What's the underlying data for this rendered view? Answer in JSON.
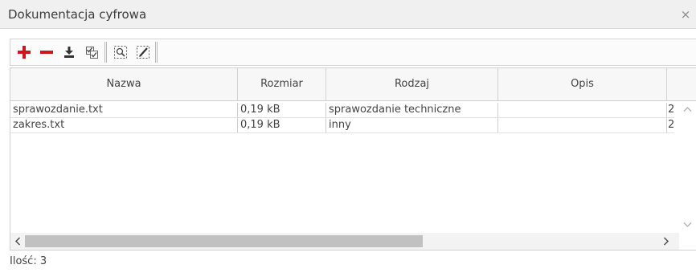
{
  "window": {
    "title": "Dokumentacja cyfrowa",
    "close_glyph": "×"
  },
  "toolbar": {
    "buttons": [
      {
        "icon": "plus-icon",
        "color": "#d0151b"
      },
      {
        "icon": "minus-icon",
        "color": "#d0151b"
      },
      {
        "icon": "download-icon",
        "color": "#333333"
      },
      {
        "icon": "checklist-icon",
        "color": "#555555"
      },
      {
        "icon": "zoom-selection-icon",
        "color": "#555555"
      },
      {
        "icon": "edit-selection-icon",
        "color": "#555555"
      }
    ]
  },
  "grid": {
    "columns": [
      "Nazwa",
      "Rozmiar",
      "Rodzaj",
      "Opis"
    ],
    "rows": [
      {
        "nazwa": "sprawozdanie.txt",
        "rozmiar": "0,19 kB",
        "rodzaj": "sprawozdanie techniczne",
        "opis": "",
        "extra": "2"
      },
      {
        "nazwa": "zakres.txt",
        "rozmiar": "0,19 kB",
        "rodzaj": "inny",
        "opis": "",
        "extra": "2"
      }
    ]
  },
  "footer": {
    "count_label": "Ilość: 3"
  }
}
